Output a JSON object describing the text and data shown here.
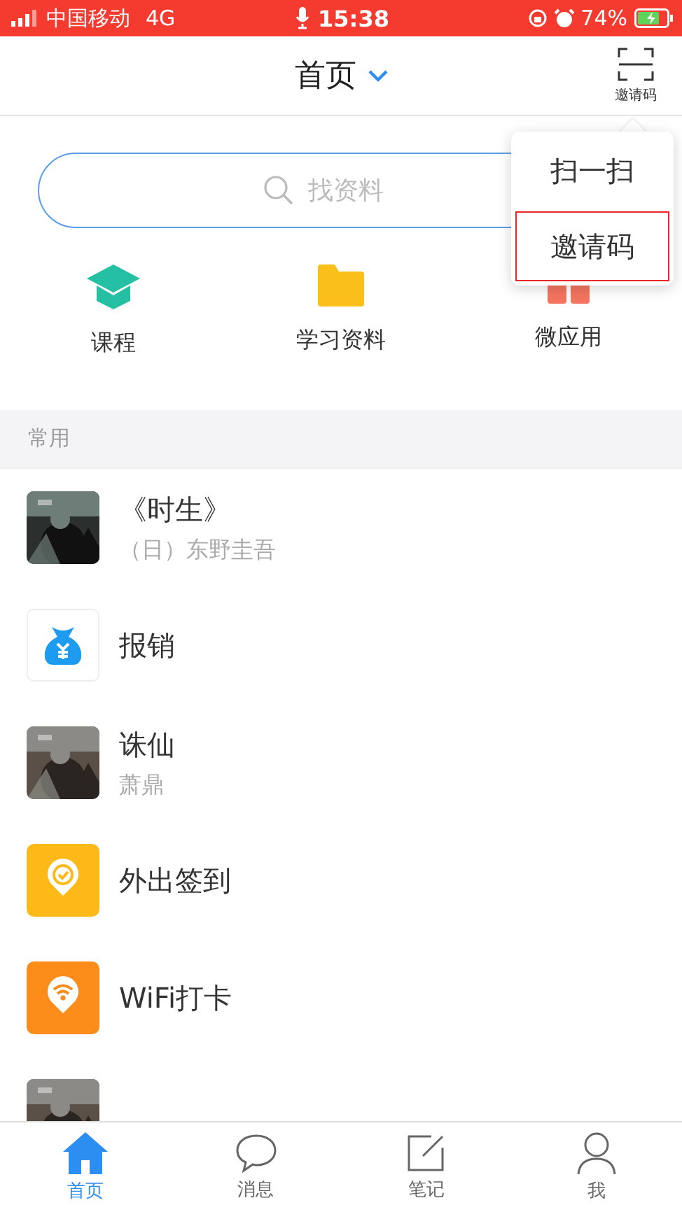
{
  "status_bar": {
    "carrier": "中国移动",
    "network": "4G",
    "time": "15:38",
    "battery": "74%"
  },
  "header": {
    "title": "首页",
    "scan_label": "邀请码"
  },
  "search": {
    "placeholder": "找资料"
  },
  "shortcuts": [
    {
      "kind": "course",
      "label": "课程"
    },
    {
      "kind": "folder",
      "label": "学习资料"
    },
    {
      "kind": "apps",
      "label": "微应用"
    }
  ],
  "popup_menu": [
    {
      "label": "扫一扫",
      "selected": false
    },
    {
      "label": "邀请码",
      "selected": true
    }
  ],
  "section_title": "常用",
  "items": [
    {
      "kind": "book",
      "title": "《时生》",
      "subtitle": "（日）东野圭吾"
    },
    {
      "kind": "money",
      "title": "报销"
    },
    {
      "kind": "book",
      "title": "诛仙",
      "subtitle": "萧鼎"
    },
    {
      "kind": "checkin",
      "title": "外出签到"
    },
    {
      "kind": "wifi",
      "title": "WiFi打卡"
    },
    {
      "kind": "book"
    }
  ],
  "tabs": [
    {
      "kind": "home",
      "label": "首页",
      "selected": true
    },
    {
      "kind": "message",
      "label": "消息",
      "selected": false
    },
    {
      "kind": "note",
      "label": "笔记",
      "selected": false
    },
    {
      "kind": "me",
      "label": "我",
      "selected": false
    }
  ]
}
